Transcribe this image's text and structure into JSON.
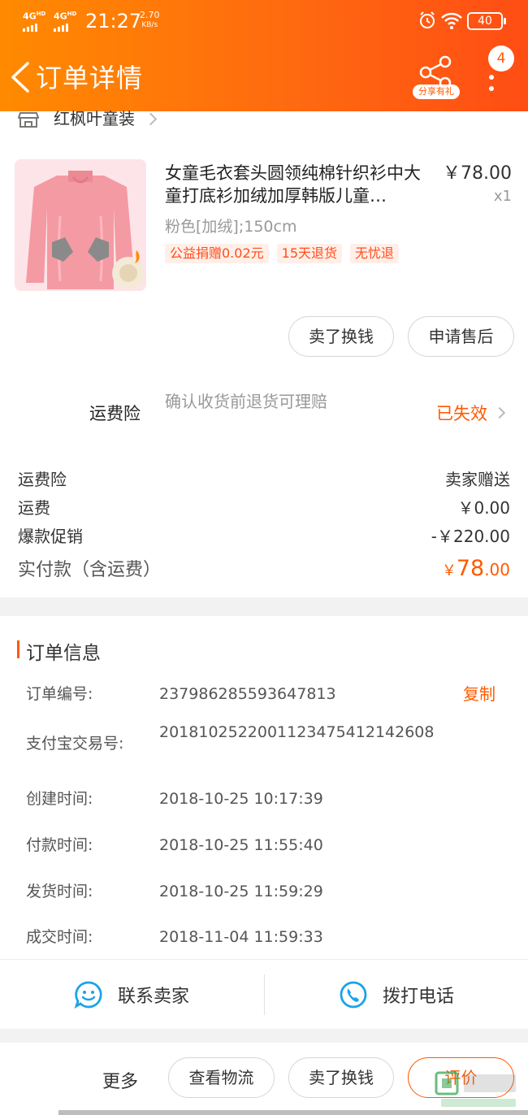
{
  "status_bar": {
    "network1": "4G",
    "network1_sup": "HD",
    "network2": "4G",
    "network2_sup": "HD",
    "time": "21:27",
    "speed_value": "2.70",
    "speed_unit": "KB/s",
    "battery": "40",
    "icons": [
      "alarm-icon",
      "wifi-icon",
      "battery-icon"
    ]
  },
  "header": {
    "title": "订单详情",
    "share_label": "分享有礼",
    "notification_count": "4",
    "icons": [
      "back-arrow-icon",
      "share-icon",
      "more-vertical-icon"
    ]
  },
  "shop": {
    "name": "红枫叶童装",
    "icon": "store-icon"
  },
  "product": {
    "title": "女童毛衣套头圆领纯棉针织衫中大童打底衫加绒加厚韩版儿童…",
    "price": "￥78.00",
    "quantity": "x1",
    "sku": "粉色[加绒];150cm",
    "tags": [
      "公益捐赠0.02元",
      "15天退货",
      "无忧退"
    ]
  },
  "product_actions": {
    "sell_label": "卖了换钱",
    "after_sale_label": "申请售后"
  },
  "insurance": {
    "label": "运费险",
    "description": "确认收货前退货可理赔",
    "status": "已失效"
  },
  "fees": {
    "rows": [
      {
        "label": "运费险",
        "value": "卖家赠送"
      },
      {
        "label": "运费",
        "value": "￥0.00"
      },
      {
        "label": "爆款促销",
        "value": "-￥220.00"
      }
    ],
    "paid_label": "实付款（含运费）",
    "paid_currency": "￥",
    "paid_integer": "78",
    "paid_decimal": ".00"
  },
  "order_info": {
    "title": "订单信息",
    "copy_label": "复制",
    "rows": [
      {
        "label": "订单编号:",
        "value": "237986285593647813"
      },
      {
        "label": "支付宝交易号:",
        "value": "2018102522001123475412142608"
      },
      {
        "label": "创建时间:",
        "value": "2018-10-25 10:17:39"
      },
      {
        "label": "付款时间:",
        "value": "2018-10-25 11:55:40"
      },
      {
        "label": "发货时间:",
        "value": "2018-10-25 11:59:29"
      },
      {
        "label": "成交时间:",
        "value": "2018-11-04 11:59:33"
      }
    ]
  },
  "contact": {
    "seller_label": "联系卖家",
    "call_label": "拨打电话",
    "icons": [
      "chat-smile-icon",
      "phone-icon"
    ]
  },
  "bottom_bar": {
    "more_label": "更多",
    "logistics_label": "查看物流",
    "sell_label": "卖了换钱",
    "review_label": "评价"
  },
  "colors": {
    "accent": "#ff5a00",
    "header_start": "#ff8a00",
    "header_end": "#ff4d14",
    "contact_blue": "#1aa3e8"
  }
}
